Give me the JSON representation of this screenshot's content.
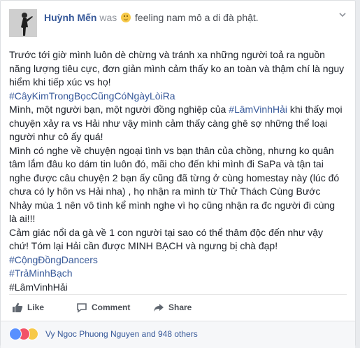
{
  "post": {
    "author": "Huỳnh Mến",
    "was": "was",
    "feeling": "feeling nam mô a di đà phật."
  },
  "content": {
    "p1": "Trước tới giờ mình luôn dè chừng và tránh xa những người toả ra nguồn năng lượng tiêu cực, đơn giản mình cảm thấy ko an toàn và thậm chí là nguy hiểm khi tiếp xúc vs họ!",
    "tag1": "#CâyKimTrongBọcCũngCóNgàyLòiRa",
    "p2a": "Mình, một người bạn, một người đồng nghiệp của ",
    "tag2": "#LâmVinhHải",
    "p2b": " khi thấy mọi chuyện xảy ra vs Hải như vậy mình cảm thấy càng ghê sợ những thể loại người như cô ấy quá!",
    "p3": "Mình có nghe về chuyện ngoại tình vs bạn thân của chồng, nhưng ko quân tâm lắm đâu ko dám tin luôn đó, mãi cho đến khi mình đi SaPa và tận tai nghe được câu chuyện 2 bạn ấy cũng đã từng ở cùng homestay này (lúc đó chưa có ly hôn vs Hải nha) , họ nhận ra mình từ Thử Thách Cùng Bước Nhảy mùa 1 nên vô tình kể mình nghe vì họ cũng nhận ra đc người đi cùng là ai!!!",
    "p4": "Cảm giác nổi da gà về 1 con người tại sao có thể thâm độc đến như vậy chứ! Tóm lại Hải cần được MINH BẠCH và ngưng bị chà đạp!",
    "tag3": "#CộngĐồngDancers",
    "tag4": "#TrảMinhBạch",
    "tag5": "#LâmVinhHải"
  },
  "actions": {
    "like": "Like",
    "comment": "Comment",
    "share": "Share"
  },
  "reactions": {
    "summary": "Vy Ngoc Phuong Nguyen and 948 others"
  }
}
